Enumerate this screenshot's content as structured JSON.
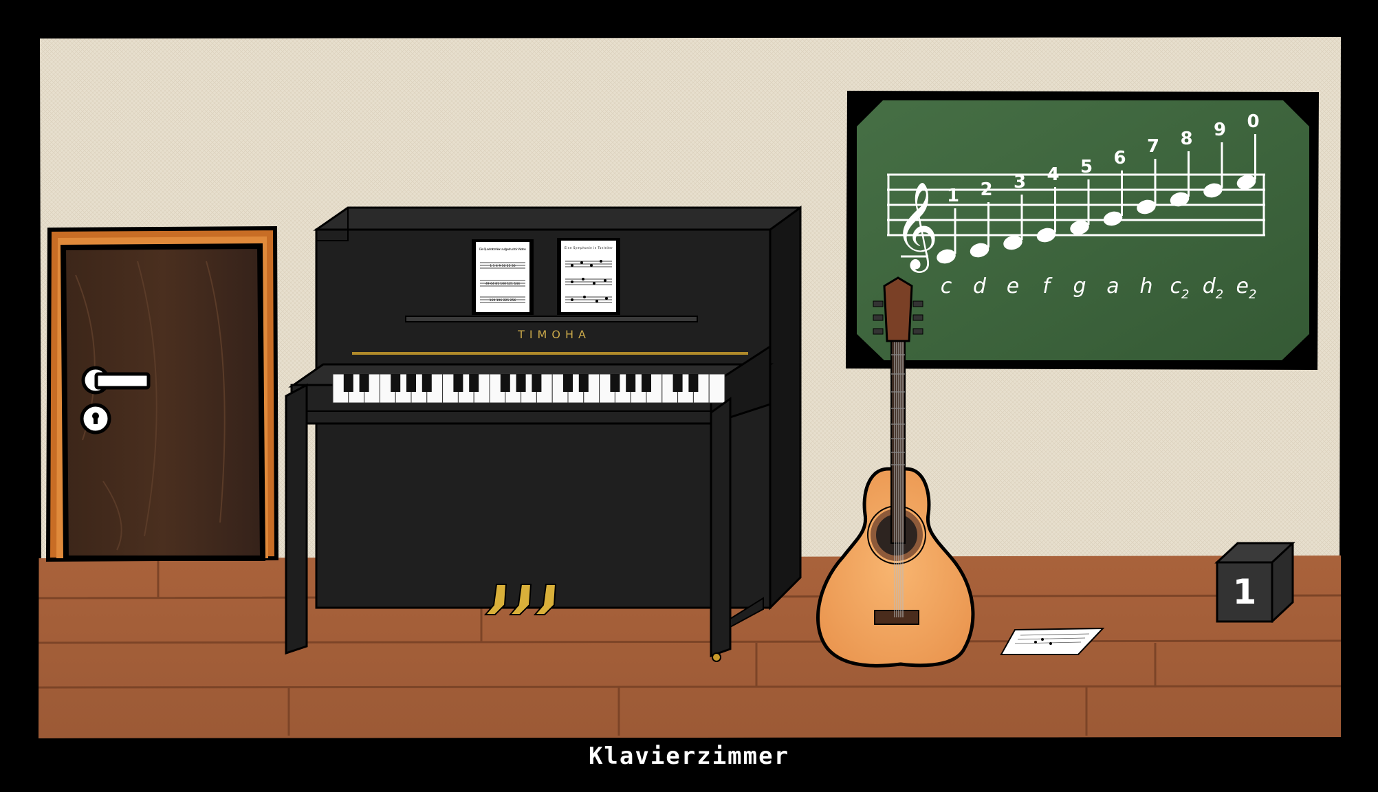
{
  "room": {
    "title": "Klavierzimmer"
  },
  "colors": {
    "wall": "#e8e0cf",
    "floor": "#a4603b",
    "chalkboard": "#3f6a3f",
    "door": "#3a2418",
    "door_frame": "#cd7a2d",
    "piano": "#1c1c1c",
    "guitar_body": "#f2a45c"
  },
  "piano": {
    "brand": "TIMOHA",
    "sheet_left": {
      "title": "Die Quadratzahlen aufgedruckt in Noten",
      "rows": [
        "1 1 4 9 16 25 36",
        "49 64 81 100 121 144",
        "169 196 225 256"
      ]
    },
    "sheet_right": {
      "title": "Eine Symphonie in Tonleiter",
      "rows": [
        "melody line 1",
        "melody line 2",
        "melody line 3"
      ]
    }
  },
  "chalkboard": {
    "numbers": [
      "1",
      "2",
      "3",
      "4",
      "5",
      "6",
      "7",
      "8",
      "9",
      "0"
    ],
    "letters": [
      {
        "main": "c",
        "sub": ""
      },
      {
        "main": "d",
        "sub": ""
      },
      {
        "main": "e",
        "sub": ""
      },
      {
        "main": "f",
        "sub": ""
      },
      {
        "main": "g",
        "sub": ""
      },
      {
        "main": "a",
        "sub": ""
      },
      {
        "main": "h",
        "sub": ""
      },
      {
        "main": "c",
        "sub": "2"
      },
      {
        "main": "d",
        "sub": "2"
      },
      {
        "main": "e",
        "sub": "2"
      }
    ]
  },
  "cube": {
    "label": "1"
  },
  "icons": {
    "door_handle": "door-handle-icon",
    "keyhole": "keyhole-icon",
    "treble_clef": "treble-clef-icon",
    "clef_glyph": "𝄞"
  }
}
